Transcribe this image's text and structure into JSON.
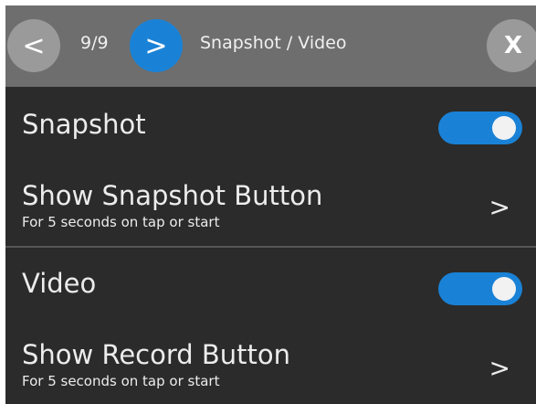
{
  "header": {
    "prev_label": "<",
    "counter": "9/9",
    "next_label": ">",
    "title": "Snapshot / Video",
    "close_label": "X"
  },
  "settings": [
    {
      "label": "Snapshot",
      "toggle": true,
      "checked": true
    },
    {
      "label": "Show Snapshot Button",
      "subtitle": "For 5 seconds on tap or start",
      "chevron": ">"
    },
    {
      "label": "Video",
      "toggle": true,
      "checked": true
    },
    {
      "label": "Show Record Button",
      "subtitle": "For 5 seconds on tap or start",
      "chevron": ">"
    }
  ],
  "colors": {
    "accent": "#1a82d6",
    "header_bg": "#6e6e6e",
    "panel_bg": "#2b2b2b",
    "text": "#ececec"
  }
}
